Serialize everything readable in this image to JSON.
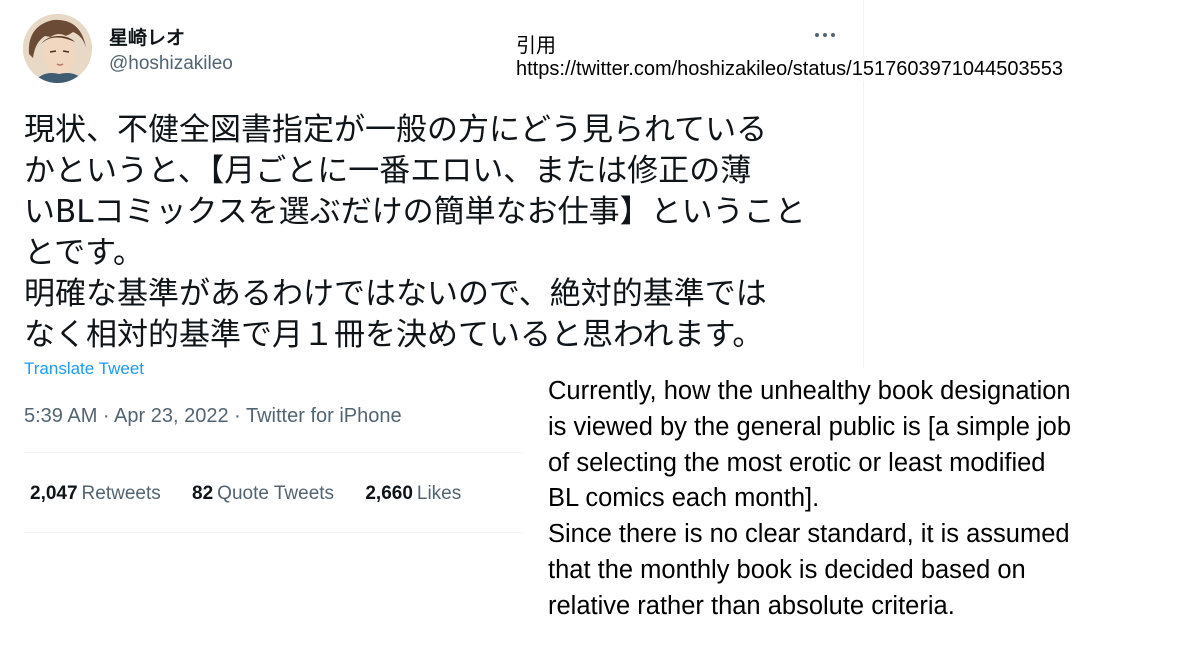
{
  "tweet": {
    "display_name": "星崎レオ",
    "handle": "@hoshizakileo",
    "text_lines": [
      "現状、不健全図書指定が一般の方にどう見られている",
      "かというと、【月ごとに一番エロい、または修正の薄",
      "いBLコミックスを選ぶだけの簡単なお仕事】ということ",
      "とです。",
      "明確な基準があるわけではないので、絶対的基準では",
      "なく相対的基準で月１冊を決めていると思われます。"
    ],
    "translate_label": "Translate Tweet",
    "timestamp": "5:39 AM · Apr 23, 2022 · Twitter for iPhone",
    "stats": {
      "retweets_count": "2,047",
      "retweets_label": "Retweets",
      "quote_count": "82",
      "quote_label": "Quote Tweets",
      "likes_count": "2,660",
      "likes_label": "Likes"
    },
    "more_icon": "more-horizontal-icon",
    "link_color": "#1d9bf0",
    "secondary_color": "#536471"
  },
  "quote": {
    "label": "引用",
    "url": "https://twitter.com/hoshizakileo/status/1517603971044503553"
  },
  "translation": {
    "lines": [
      "Currently, how the unhealthy book designation",
      "is viewed by the general public is [a simple job",
      "of selecting the most erotic or least modified",
      "BL comics each month].",
      "Since there is no clear standard, it is assumed",
      "that the monthly book is decided based on",
      "relative rather than absolute criteria."
    ]
  }
}
